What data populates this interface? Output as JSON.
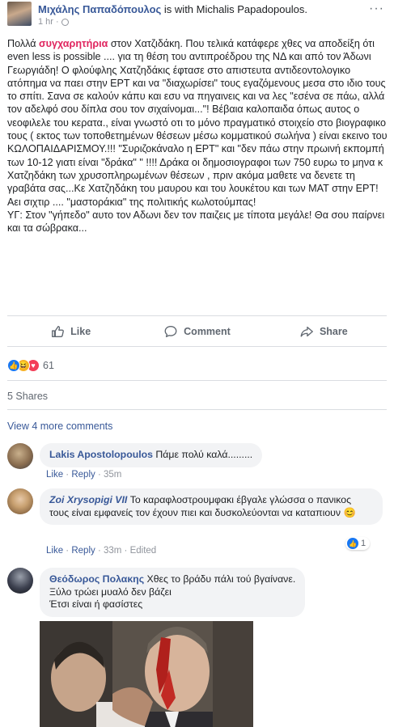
{
  "post": {
    "author": "Μιχάλης Παπαδόπουλος",
    "with_text": "is with Michalis Papadopoulos.",
    "time": "1 hr ·",
    "more_icon": "more-dots-icon",
    "privacy_icon": "globe-icon",
    "text": {
      "line1_pre": "Πολλά ",
      "line1_hl": "συγχαρητήρια",
      "line1_post": " στον Χατζιδάκη. Που τελικά κατάφερε χθες να αποδείξη ότι even less is possible .... για τη θέση του αντιπροέδρου της ΝΔ και από τον Άδωνι Γεωργιάδη! Ο φλούφλης Χατζηδάκις έφτασε στο απιστευτα αντιδεοντολογικο ατόπημα να παει στην ΕΡΤ και να \"διαχωρίσει\" τους εγαζόμενους μεσα στο ιδιο τους το σπίτι. Σανα σε καλούν κάπυ και εσυ να πηγαινεις και να λες \"εσένα σε πάω, αλλά τον αδελφό σου δίπλα σου τον σιχαίνομαι...\"! Βέβαια καλοπαιδα όπως αυτος ο νεοφιλελε του κερατα., είναι γνωστό οτι το μόνο πραγματικό στοιχείο στο βιογραφικο τους ( εκτος των τοποθετημένων θέσεων μέσω κομματικού σωλήνα ) είναι εκεινο του ΚΩΛΟΠΑΙΔΑΡΙΣΜΟΥ.!!! \"Συριζοκάναλο η ΕΡΤ\" και \"δεν πάω στην πρωινή εκπομπή των 10-12 γιατι είναι \"δράκα\" \" !!!! Δράκα οι δημοσιογραφοι των 750 ευρω το μηνα κ Χατζηδάκη των χρυσοπληρωμένων θέσεων , πριν ακόμα μαθετε να δενετε τη γραβάτα σας...Κε Χατζηδάκη του μαυρου και του λουκέτου και των ΜΑΤ στην ΕΡΤ! Αει σιχτιρ .... \"μαστοράκια\" της πολιτικής κωλοτούμπας!",
      "line2": "ΥΓ: Στον \"γήπεδο\" αυτο τον Αδωνι δεν τον παιζεις με τίποτα μεγάλε! Θα σου παίρνει και τα σώβρακα..."
    }
  },
  "actions": {
    "like": "Like",
    "comment": "Comment",
    "share": "Share"
  },
  "stats": {
    "reaction_count": "61",
    "shares": "5 Shares",
    "view_more": "View 4 more comments"
  },
  "comments": [
    {
      "author": "Lakis Apostolopoulos",
      "text": "Πάμε πολύ καλά.........",
      "like": "Like",
      "reply": "Reply",
      "time": "35m"
    },
    {
      "author": "Zoi Xrysopigi VII",
      "text": "Το καραφλοστρουμφακι έβγαλε γλώσσα ο πανικος τους είναι εμφανείς τον έχουν πιει και δυσκολεύονται να καταπιουν 😊",
      "like": "Like",
      "reply": "Reply",
      "time": "33m",
      "edited": "Edited",
      "reaction_count": "1"
    },
    {
      "author": "Θεόδωρος Πολακης",
      "text1": "Χθες το βράδυ πάλι τού βγαίνανε.",
      "text2": "Ξύλο τρώει μυαλό δεν βάζει",
      "text3": "Έτσι είναι ή φασίστες"
    }
  ],
  "colors": {
    "link": "#385898",
    "highlight": "#e0245e",
    "muted": "#606770",
    "bubble": "#f2f3f5"
  }
}
